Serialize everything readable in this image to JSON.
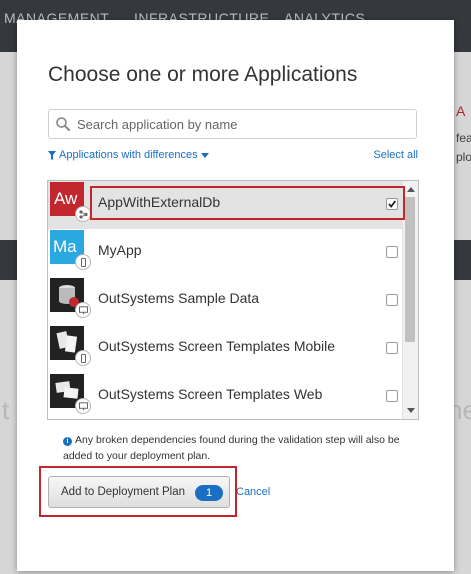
{
  "background": {
    "nav": [
      "MANAGEMENT",
      "INFRASTRUCTURE",
      "ANALYTICS"
    ],
    "right_snippets": [
      "A",
      "fea",
      "ploy"
    ],
    "big_text_left": "t",
    "big_text_right": "ne"
  },
  "modal": {
    "title": "Choose one or more Applications",
    "search": {
      "placeholder": "Search application by name",
      "value": ""
    },
    "filter_label": "Applications with differences",
    "select_all_label": "Select all",
    "apps": [
      {
        "name": "AppWithExternalDb",
        "abbr": "Aw",
        "icon_color": "#c1272d",
        "type_icon": "integration-icon",
        "checked": true,
        "selected": true
      },
      {
        "name": "MyApp",
        "abbr": "Ma",
        "icon_color": "#2aa9e0",
        "type_icon": "mobile-icon",
        "checked": false,
        "selected": false
      },
      {
        "name": "OutSystems Sample Data",
        "abbr": "",
        "icon_color": "#222222",
        "type_icon": "web-icon",
        "checked": false,
        "selected": false
      },
      {
        "name": "OutSystems Screen Templates Mobile",
        "abbr": "",
        "icon_color": "#222222",
        "type_icon": "mobile-icon",
        "checked": false,
        "selected": false
      },
      {
        "name": "OutSystems Screen Templates Web",
        "abbr": "",
        "icon_color": "#222222",
        "type_icon": "web-icon",
        "checked": false,
        "selected": false
      }
    ],
    "info_text": "Any broken dependencies found during the validation step will also be added to your deployment plan.",
    "add_button_label": "Add to Deployment Plan",
    "add_button_count": "1",
    "cancel_label": "Cancel"
  }
}
